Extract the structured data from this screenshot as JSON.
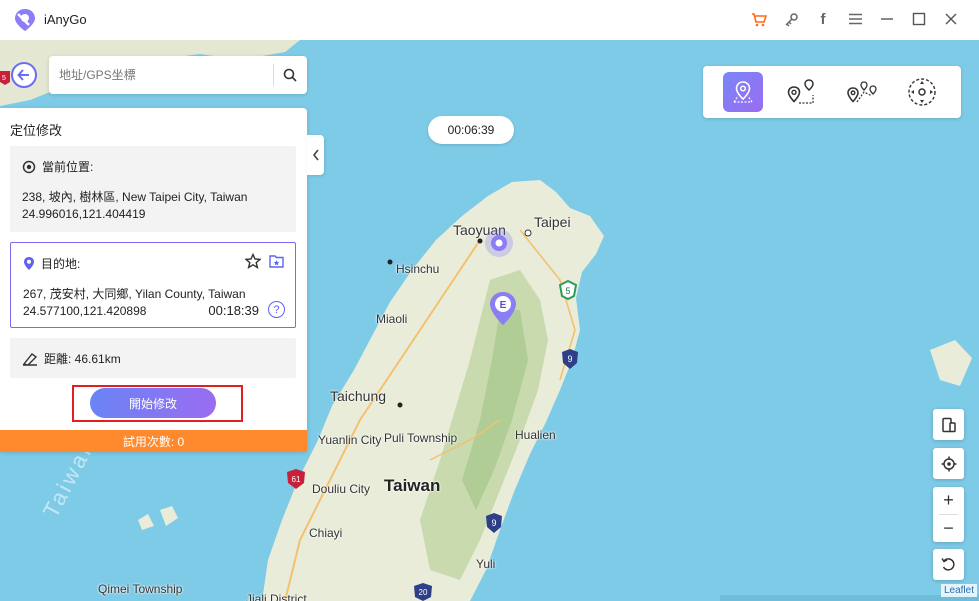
{
  "app": {
    "title": "iAnyGo"
  },
  "titlebar": {
    "icons": [
      "cart-icon",
      "key-icon",
      "facebook-icon",
      "menu-icon",
      "minimize-icon",
      "maximize-icon",
      "close-icon"
    ],
    "facebook_glyph": "f"
  },
  "search": {
    "placeholder": "地址/GPS坐標"
  },
  "timer": {
    "value": "00:06:39"
  },
  "panel": {
    "title": "定位修改",
    "current": {
      "label": "當前位置:",
      "address": "238, 坡內, 樹林區, New Taipei City, Taiwan",
      "coords": "24.996016,121.404419"
    },
    "destination": {
      "label": "目的地:",
      "address": "267, 茂安村, 大同鄉, Yilan County, Taiwan",
      "coords": "24.577100,121.420898",
      "time": "00:18:39"
    },
    "distance": {
      "label": "距離: 46.61km"
    },
    "start_button": "開始修改",
    "trial": "試用次數: 0",
    "help_glyph": "?"
  },
  "modes": [
    "teleport-mode",
    "two-spot-mode",
    "multi-spot-mode",
    "joystick-mode"
  ],
  "zoom": {
    "in": "+",
    "out": "−"
  },
  "map": {
    "labels": {
      "taipei": "Taipei",
      "taoyuan": "Taoyuan",
      "hsinchu": "Hsinchu",
      "miaoli": "Miaoli",
      "taichung": "Taichung",
      "yunlin": "Yuanlin City",
      "puli": "Puli Township",
      "hualien": "Hualien",
      "douliu": "Douliu City",
      "taiwan": "Taiwan",
      "chiayi": "Chiayi",
      "yuli": "Yuli",
      "qimei": "Qimei Township",
      "jiali": "Jiali District"
    },
    "watermark": "Taiwan",
    "marker_letter": "E",
    "shields": {
      "s5": "5",
      "s9a": "9",
      "s9b": "9",
      "s61": "61",
      "s20": "20",
      "s5b": "5"
    },
    "attribution": "Leaflet"
  },
  "colors": {
    "accent": "#7a6cf0",
    "water": "#7ecbe8",
    "land": "#e9ecd8",
    "trial": "#ff8a2d",
    "highlight": "#e02020"
  }
}
